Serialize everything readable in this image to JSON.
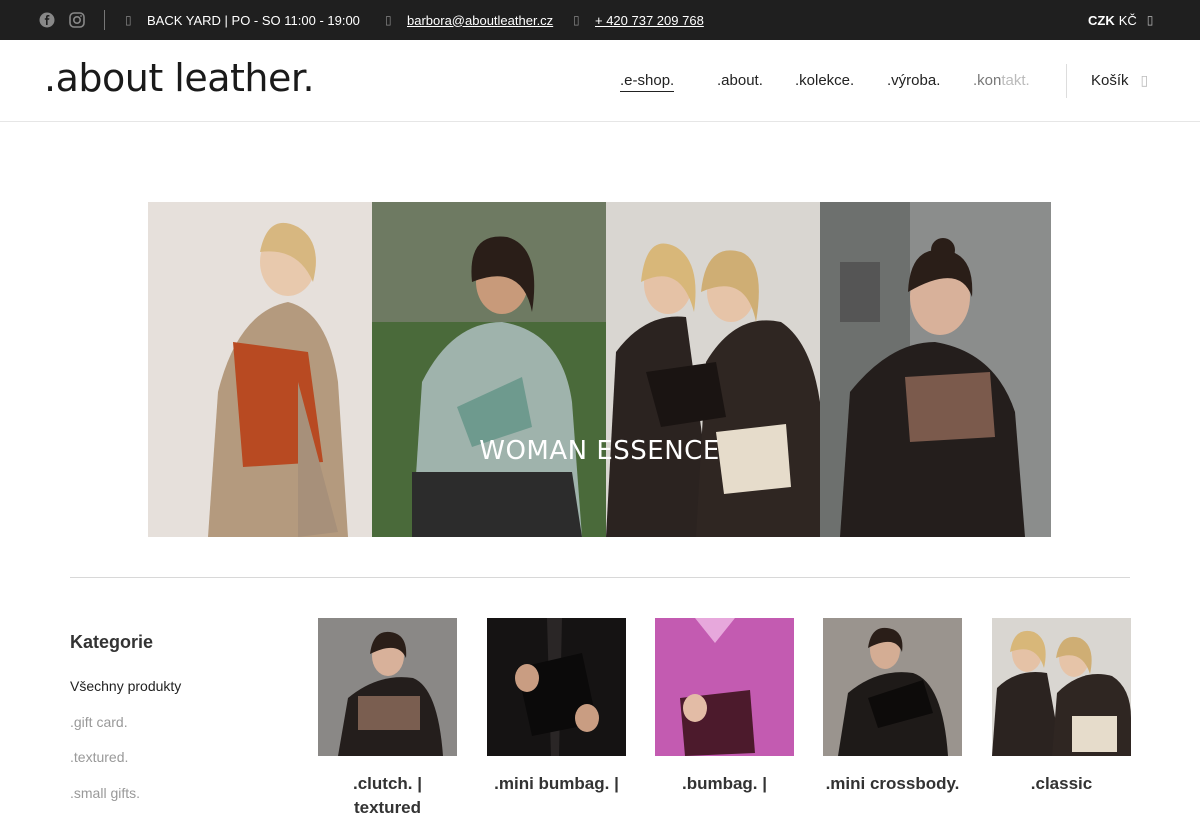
{
  "topbar": {
    "hours": "BACK YARD | PO - SO  11:00 - 19:00",
    "email": "barbora@aboutleather.cz",
    "phone": "+ 420 737 209 768",
    "currency_code": "CZK",
    "currency_label": "KČ"
  },
  "header": {
    "logo": ".about leather.",
    "nav": [
      {
        "label": ".e-shop."
      },
      {
        "label": ".about."
      },
      {
        "label": ".kolekce."
      },
      {
        "label": ".výroba."
      },
      {
        "label_a": ".kon",
        "label_b": "takt."
      }
    ],
    "cart_label": "Košík"
  },
  "banner": {
    "title": "WOMAN ESSENCE"
  },
  "sidebar": {
    "title": "Kategorie",
    "items": [
      {
        "label": "Všechny produkty"
      },
      {
        "label": ".gift card."
      },
      {
        "label": ".textured."
      },
      {
        "label": ".small gifts."
      }
    ]
  },
  "products": [
    {
      "name": ".clutch. | textured"
    },
    {
      "name": ".mini bumbag. |"
    },
    {
      "name": ".bumbag. |"
    },
    {
      "name": ".mini crossbody."
    },
    {
      "name": ".classic"
    }
  ],
  "colors": {
    "topbar_bg": "#1f1f1f",
    "accent": "#222222"
  }
}
